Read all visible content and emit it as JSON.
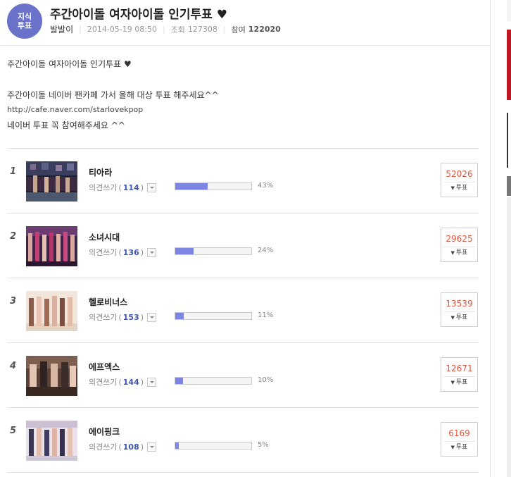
{
  "header": {
    "badge_line1": "지식",
    "badge_line2": "투표",
    "title": "주간아이돌 여자아이돌 인기투표 ♥",
    "author": "발발이",
    "date": "2014-05-19 08:50",
    "views_label": "조회",
    "views": "127308",
    "participants_label": "참여",
    "participants": "122020"
  },
  "description": {
    "line1": "주간아이돌 여자아이돌 인기투표 ♥",
    "line2": "주간아이돌 네이버 팬카페 가서 올해 대상 투표 해주세요^^",
    "url": "http://cafe.naver.com/starlovekpop",
    "line3": "네이버 투표 꼭 참여해주세요 ^^"
  },
  "labels": {
    "opinion": "의견쓰기",
    "vote_button": "투표",
    "paren_open": "(",
    "paren_close": ")"
  },
  "items": [
    {
      "rank": "1",
      "name": "티아라",
      "opinions": "114",
      "percent": "43%",
      "fraction": 0.43,
      "votes": "52026"
    },
    {
      "rank": "2",
      "name": "소녀시대",
      "opinions": "136",
      "percent": "24%",
      "fraction": 0.24,
      "votes": "29625"
    },
    {
      "rank": "3",
      "name": "헬로비너스",
      "opinions": "153",
      "percent": "11%",
      "fraction": 0.11,
      "votes": "13539"
    },
    {
      "rank": "4",
      "name": "에프엑스",
      "opinions": "144",
      "percent": "10%",
      "fraction": 0.1,
      "votes": "12671"
    },
    {
      "rank": "5",
      "name": "에이핑크",
      "opinions": "108",
      "percent": "5%",
      "fraction": 0.05,
      "votes": "6169"
    }
  ],
  "colors": {
    "badge": "#6a73c9",
    "bar_fill": "#7c84e4",
    "vote_count": "#e2553f",
    "opinion_count": "#3f57b5"
  }
}
